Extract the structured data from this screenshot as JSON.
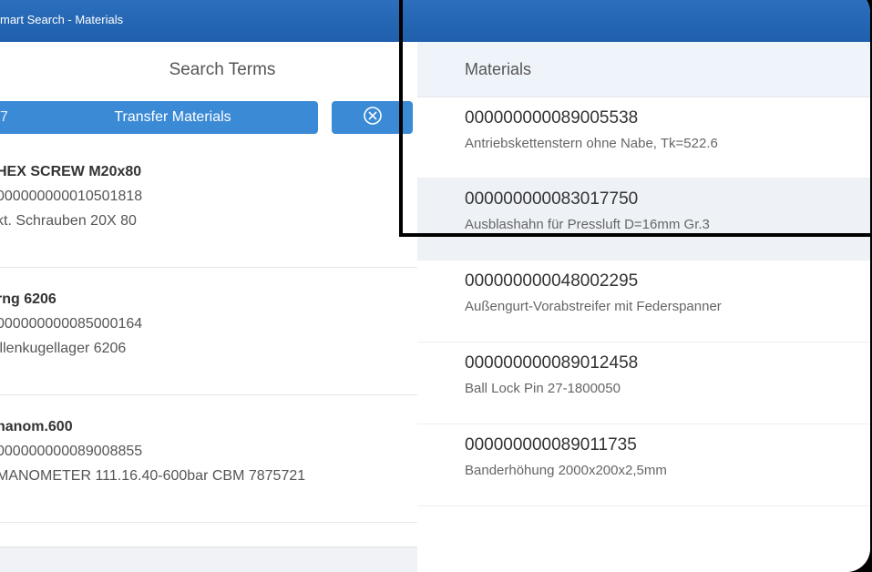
{
  "window": {
    "title": "mart Search - Materials"
  },
  "search_terms": {
    "header": "Search Terms",
    "transfer_button": {
      "lead": "7",
      "label": "Transfer Materials"
    },
    "clear_button_icon": "close-circle-icon",
    "items": [
      {
        "name": "HEX SCREW M20x80",
        "number": "000000000010501818",
        "desc": "kt. Schrauben 20X 80"
      },
      {
        "name": "rng 6206",
        "number": "000000000085000164",
        "desc": "illenkugellager 6206"
      },
      {
        "name": "nanom.600",
        "number": "000000000089008855",
        "desc": "MANOMETER 111.16.40-600bar CBM 7875721"
      }
    ]
  },
  "materials": {
    "header": "Materials",
    "items": [
      {
        "number": "000000000089005538",
        "desc": "Antriebskettenstern ohne Nabe, Tk=522.6"
      },
      {
        "number": "000000000083017750",
        "desc": "Ausblashahn für Pressluft D=16mm Gr.3"
      },
      {
        "number": "000000000048002295",
        "desc": "Außengurt-Vorabstreifer mit Federspanner"
      },
      {
        "number": "000000000089012458",
        "desc": "Ball Lock Pin 27-1800050"
      },
      {
        "number": "000000000089011735",
        "desc": "Banderhöhung 2000x200x2,5mm"
      }
    ]
  }
}
